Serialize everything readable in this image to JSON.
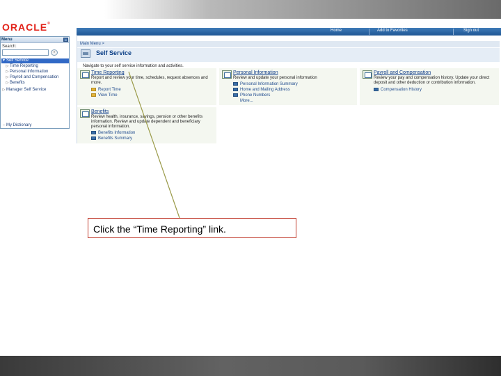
{
  "colors": {
    "oracle_red": "#e2231a",
    "nav_blue": "#2a63a3",
    "link_blue": "#123f8a",
    "callout_border": "#c0392b",
    "callout_line": "#9a9a48"
  },
  "header": {
    "logo": "ORACLE",
    "logo_mark": "®",
    "nav": [
      "Home",
      "Add to Favorites",
      "Sign out"
    ]
  },
  "menu": {
    "title": "Menu",
    "search_label": "Search:",
    "search_value": "",
    "search_button": "»",
    "items": [
      {
        "label": "Self Service",
        "marker": "▼",
        "selected": true
      },
      {
        "label": "Time Reporting",
        "marker": "▷"
      },
      {
        "label": "Personal Information",
        "marker": "▷"
      },
      {
        "label": "Payroll and Compensation",
        "marker": "▷"
      },
      {
        "label": "Benefits",
        "marker": "▷"
      },
      {
        "label": "Manager Self Service",
        "marker": "▷"
      },
      {
        "label": "My Dictionary",
        "marker": "–"
      }
    ]
  },
  "main": {
    "breadcrumb": "Main Menu >",
    "title": "Self Service",
    "description": "Navigate to your self service information and activities.",
    "sections": [
      {
        "title": "Time Reporting",
        "description": "Report and review your time, schedules, request absences and more.",
        "links": [
          "Report Time",
          "View Time"
        ]
      },
      {
        "title": "Personal Information",
        "description": "Review and update your personal information",
        "links": [
          "Personal Information Summary",
          "Home and Mailing Address",
          "Phone Numbers",
          "More..."
        ]
      },
      {
        "title": "Payroll and Compensation",
        "description": "Review your pay and compensation history. Update your direct deposit and other deduction or contribution information.",
        "links": [
          "Compensation History"
        ]
      },
      {
        "title": "Benefits",
        "description": "Review health, insurance, savings, pension or other benefits information. Review and update dependent and beneficiary personal information.",
        "links": [
          "Benefits Information",
          "Benefits Summary"
        ]
      }
    ]
  },
  "callout": {
    "text": "Click the “Time Reporting” link."
  }
}
